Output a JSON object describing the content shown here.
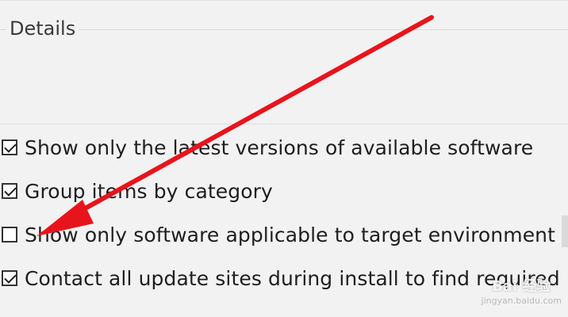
{
  "details": {
    "legend": "Details"
  },
  "options": [
    {
      "label": "Show only the latest versions of available software",
      "checked": true
    },
    {
      "label": "Group items by category",
      "checked": true
    },
    {
      "label": "Show only software applicable to target environment",
      "checked": false
    },
    {
      "label": "Contact all update sites during install to find required",
      "checked": true
    }
  ],
  "annotation": {
    "arrow_color": "#e8141c"
  },
  "watermark": {
    "text": "Bai 经验",
    "sub": "jingyan.baidu.com"
  }
}
